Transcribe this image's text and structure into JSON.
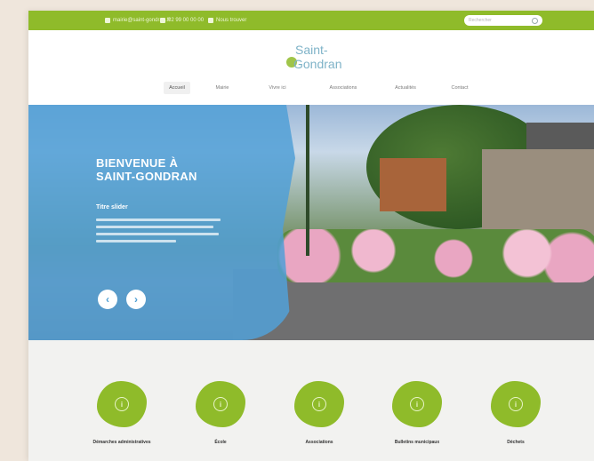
{
  "topbar": {
    "items": [
      {
        "label": "mairie@saint-gondran.fr",
        "icon": "mail-icon"
      },
      {
        "label": "02 99 00 00 00",
        "icon": "phone-icon"
      },
      {
        "label": "Nous trouver",
        "icon": "map-pin-icon"
      }
    ],
    "search_placeholder": "Rechercher"
  },
  "logo": {
    "line1": "Saint-",
    "line2": "Gondran"
  },
  "nav": {
    "items": [
      "Accueil",
      "Mairie",
      "Vivre ici",
      "Associations",
      "Actualités",
      "Contact"
    ],
    "active": "Accueil"
  },
  "hero": {
    "title_line1": "BIENVENUE À",
    "title_line2": "SAINT-GONDRAN",
    "slide_title": "Titre slider",
    "prev": "‹",
    "next": "›"
  },
  "quick_access": [
    {
      "label": "Démarches administratives",
      "icon": "info-icon"
    },
    {
      "label": "École",
      "icon": "info-icon"
    },
    {
      "label": "Associations",
      "icon": "info-icon"
    },
    {
      "label": "Bulletins municipaux",
      "icon": "info-icon"
    },
    {
      "label": "Déchets",
      "icon": "info-icon"
    }
  ],
  "colors": {
    "accent": "#8fbb2a",
    "hero_overlay": "#52a0d6"
  }
}
